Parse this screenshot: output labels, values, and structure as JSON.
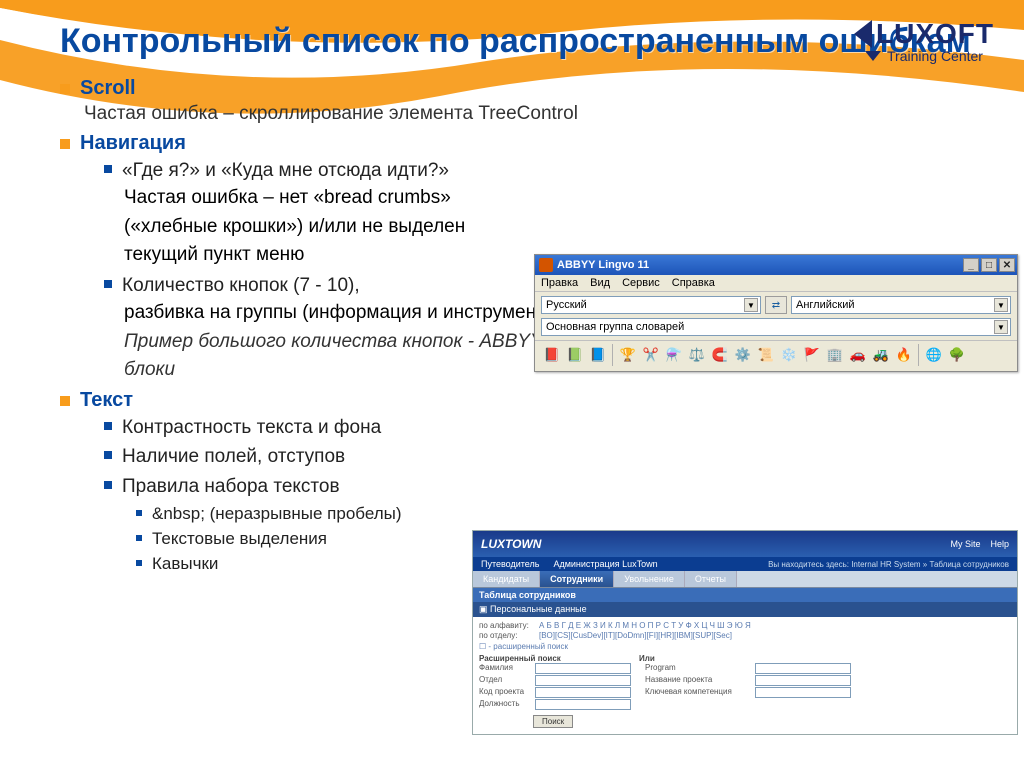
{
  "slide": {
    "title": "Контрольный список по распространенным ошибкам"
  },
  "logo": {
    "name": "LUXOFT",
    "sub": "Training Center"
  },
  "bullets": {
    "scroll": {
      "head": "Scroll",
      "sub": "Частая ошибка – скроллирование элемента TreeControl"
    },
    "nav": {
      "head": "Навигация",
      "q": "«Где я?» и «Куда мне отсюда идти?»",
      "err1": "Частая ошибка – нет «bread crumbs»",
      "err2": "(«хлебные крошки») и/или не выделен",
      "err3": "текущий пункт меню",
      "buttons": "Количество кнопок (7 - 10),",
      "groups": "разбивка на группы (информация и инструменты)",
      "example": "Пример большого количества кнопок - ABBYY Lingvo, пример разбиения номера телефона на блоки"
    },
    "text": {
      "head": "Текст",
      "contrast": "Контрастность текста и фона",
      "fields": "Наличие полей, отступов",
      "rules": "Правила набора текстов",
      "nbsp": "&nbsp; (неразрывные пробелы)",
      "highlights": "Текстовые выделения",
      "quotes": "Кавычки"
    }
  },
  "abbyy": {
    "title": "ABBYY Lingvo 11",
    "menu": [
      "Правка",
      "Вид",
      "Сервис",
      "Справка"
    ],
    "lang_from": "Русский",
    "lang_to": "Английский",
    "dict_group": "Основная группа словарей"
  },
  "luxtown": {
    "brand": "LUXTOWN",
    "hdr_links": [
      "My Site",
      "Help"
    ],
    "nav": [
      "Путеводитель",
      "Администрация LuxTown"
    ],
    "crumb": "Вы находитесь здесь: Internal HR System » Таблица сотрудников",
    "tabs": [
      "Кандидаты",
      "Сотрудники",
      "Увольнение",
      "Отчеты"
    ],
    "section": "Таблица сотрудников",
    "subsection": "Персональные данные",
    "by_alpha_lbl": "по алфавиту:",
    "by_alpha": "А Б В Г Д Е Ж З И К Л М Н О П Р С Т У Ф Х Ц Ч Ш Э Ю Я",
    "by_dept_lbl": "по отделу:",
    "by_dept": "[BO][CS][CusDev][IT][DoDmn][FI][HR][IBM][SUP][Sec]",
    "adv_toggle": "- расширенный поиск",
    "adv_hdr1": "Расширенный поиск",
    "adv_hdr2": "Или",
    "f_surname": "Фамилия",
    "f_dept": "Отдел",
    "f_proj_code": "Код проекта",
    "f_position": "Должность",
    "f_program": "Program",
    "f_proj_name": "Название проекта",
    "f_competence": "Ключевая компетенция",
    "search_btn": "Поиск"
  }
}
